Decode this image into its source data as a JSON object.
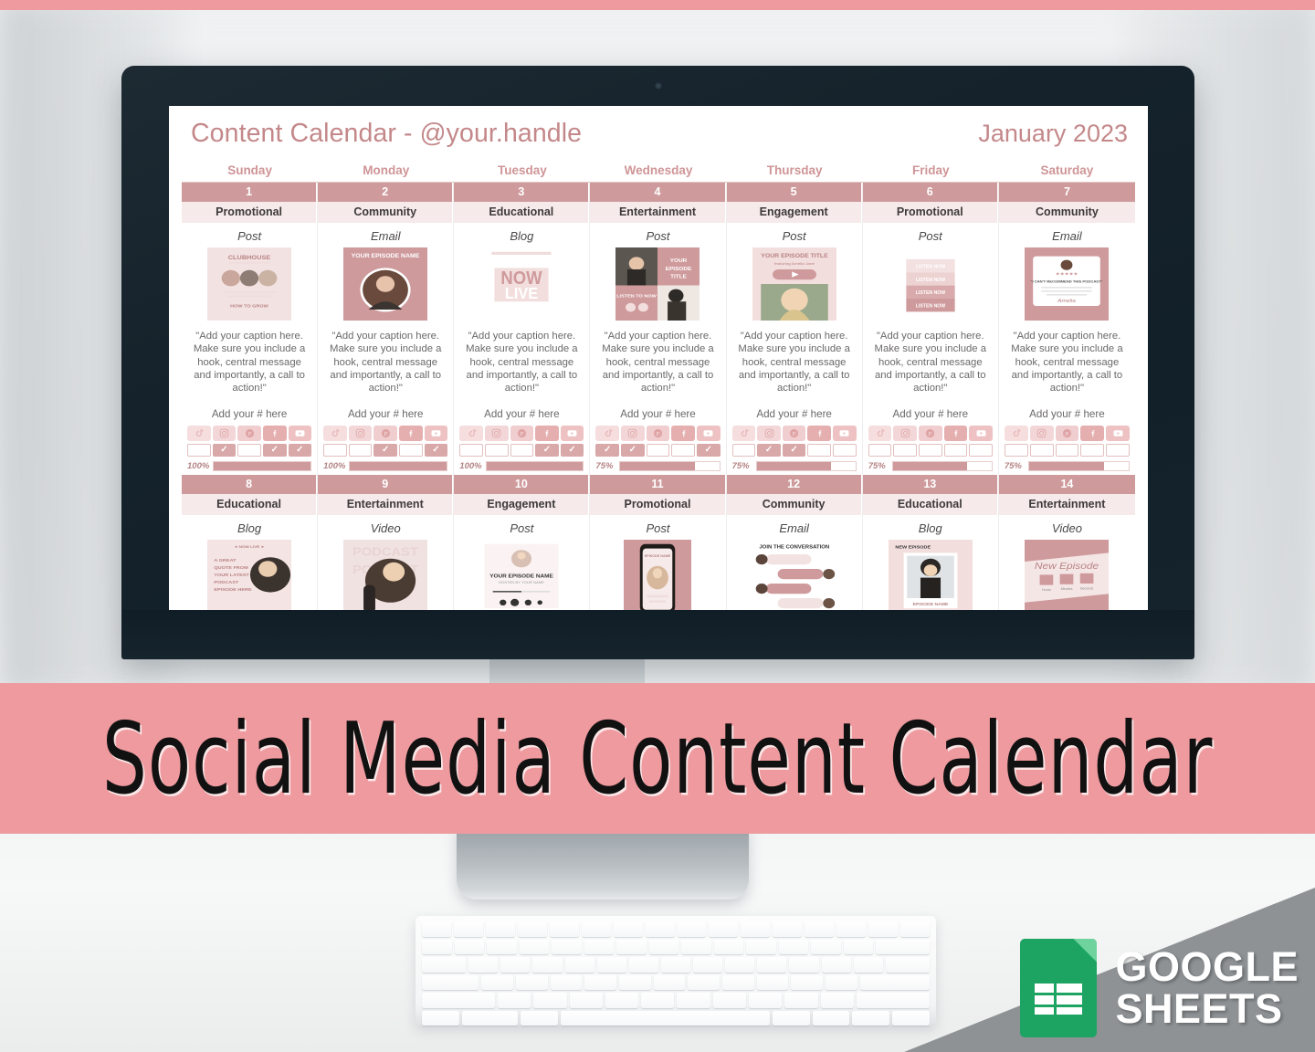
{
  "product": {
    "banner_text": "Social Media Content Calendar",
    "banner_color": "#ef9a9e",
    "badge_line1": "GOOGLE",
    "badge_line2": "SHEETS",
    "badge_icon": "google-sheets-icon"
  },
  "sheet": {
    "title": "Content Calendar - @your.handle",
    "month": "January 2023",
    "accent_color": "#cf9a9c",
    "header_text_color": "#c4888a",
    "day_names": [
      "Sunday",
      "Monday",
      "Tuesday",
      "Wednesday",
      "Thursday",
      "Friday",
      "Saturday"
    ],
    "caption_placeholder": "\"Add your caption here. Make sure you include a hook, central message and importantly, a call to action!\"",
    "hashtag_placeholder": "Add your # here",
    "platforms": [
      "tiktok-icon",
      "instagram-icon",
      "pinterest-icon",
      "facebook-icon",
      "youtube-icon"
    ],
    "weeks": [
      {
        "days": [
          {
            "num": "1",
            "category": "Promotional",
            "format": "Post",
            "thumb": "clubhouse-promo-graphic",
            "checks": [
              false,
              true,
              false,
              true,
              true
            ],
            "percent": "100%",
            "percent_value": 100
          },
          {
            "num": "2",
            "category": "Community",
            "format": "Email",
            "thumb": "your-episode-name-email",
            "checks": [
              false,
              false,
              true,
              false,
              true
            ],
            "percent": "100%",
            "percent_value": 100
          },
          {
            "num": "3",
            "category": "Educational",
            "format": "Blog",
            "thumb": "now-live-graphic",
            "checks": [
              false,
              false,
              false,
              true,
              true
            ],
            "percent": "100%",
            "percent_value": 100
          },
          {
            "num": "4",
            "category": "Entertainment",
            "format": "Post",
            "thumb": "listen-to-now-collage",
            "checks": [
              true,
              true,
              false,
              false,
              true
            ],
            "percent": "75%",
            "percent_value": 75
          },
          {
            "num": "5",
            "category": "Engagement",
            "format": "Post",
            "thumb": "your-episode-title-player",
            "checks": [
              false,
              true,
              true,
              false,
              false
            ],
            "percent": "75%",
            "percent_value": 75
          },
          {
            "num": "6",
            "category": "Promotional",
            "format": "Post",
            "thumb": "listen-now-stack",
            "checks": [
              false,
              false,
              false,
              false,
              false
            ],
            "percent": "75%",
            "percent_value": 75
          },
          {
            "num": "7",
            "category": "Community",
            "format": "Email",
            "thumb": "testimonial-review-card",
            "checks": [
              false,
              false,
              false,
              false,
              false
            ],
            "percent": "75%",
            "percent_value": 75
          }
        ]
      },
      {
        "days": [
          {
            "num": "8",
            "category": "Educational",
            "format": "Blog",
            "thumb": "great-quote-podcast"
          },
          {
            "num": "9",
            "category": "Entertainment",
            "format": "Video",
            "thumb": "podcast-recording-photo"
          },
          {
            "num": "10",
            "category": "Engagement",
            "format": "Post",
            "thumb": "episode-audio-player"
          },
          {
            "num": "11",
            "category": "Promotional",
            "format": "Post",
            "thumb": "phone-mockup-episode"
          },
          {
            "num": "12",
            "category": "Community",
            "format": "Email",
            "thumb": "join-the-conversation-chat"
          },
          {
            "num": "13",
            "category": "Educational",
            "format": "Blog",
            "thumb": "new-episode-polaroid"
          },
          {
            "num": "14",
            "category": "Entertainment",
            "format": "Video",
            "thumb": "new-episode-countdown"
          }
        ]
      }
    ]
  }
}
